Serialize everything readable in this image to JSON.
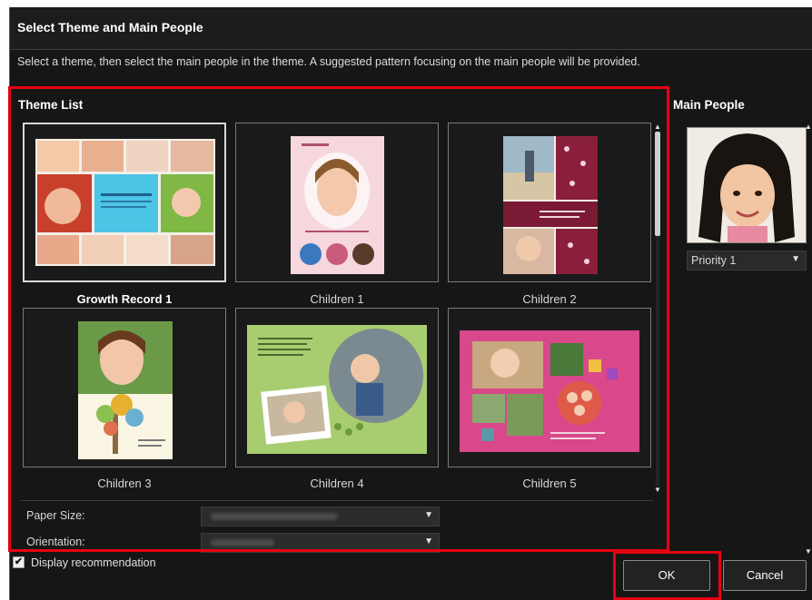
{
  "dialog": {
    "title": "Select Theme and Main People",
    "instruction": "Select a theme, then select the main people in the theme. A suggested pattern focusing on the main people will be provided."
  },
  "theme_list": {
    "title": "Theme List",
    "items": [
      {
        "label": "Growth Record 1",
        "selected": true
      },
      {
        "label": "Children 1",
        "selected": false
      },
      {
        "label": "Children 2",
        "selected": false
      },
      {
        "label": "Children 3",
        "selected": false
      },
      {
        "label": "Children 4",
        "selected": false
      },
      {
        "label": "Children 5",
        "selected": false
      }
    ]
  },
  "settings": {
    "paper_size_label": "Paper Size:",
    "orientation_label": "Orientation:"
  },
  "main_people": {
    "title": "Main People",
    "priority_value": "Priority 1"
  },
  "footer": {
    "display_recommendation_label": "Display recommendation",
    "display_recommendation_checked": true,
    "check_mark": "✔",
    "ok_label": "OK",
    "cancel_label": "Cancel"
  },
  "icons": {
    "dropdown": "chevron-down-icon",
    "scroll_up": "arrow-up-icon",
    "scroll_down": "arrow-down-icon",
    "checkbox": "check-icon"
  },
  "colors": {
    "highlight": "#e60012",
    "background": "#161616",
    "text": "#ffffff"
  }
}
